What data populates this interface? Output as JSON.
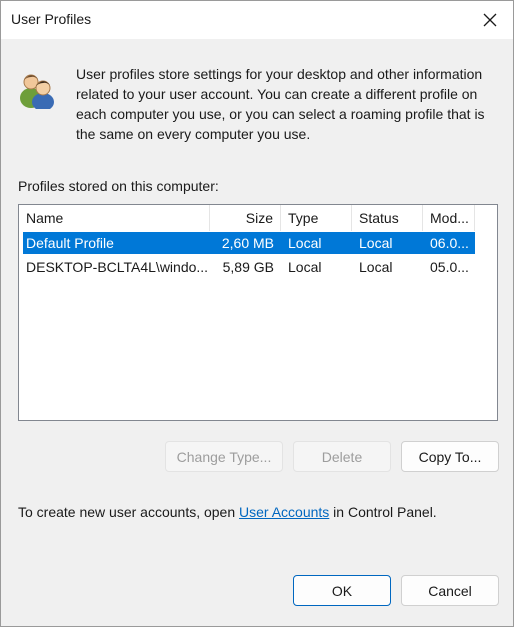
{
  "window": {
    "title": "User Profiles"
  },
  "intro_text": "User profiles store settings for your desktop and other information related to your user account. You can create a different profile on each computer you use, or you can select a roaming profile that is the same on every computer you use.",
  "profiles": {
    "label": "Profiles stored on this computer:",
    "columns": [
      "Name",
      "Size",
      "Type",
      "Status",
      "Mod..."
    ],
    "rows": [
      {
        "name": "Default Profile",
        "size": "2,60 MB",
        "type": "Local",
        "status": "Local",
        "modified": "06.0...",
        "selected": true
      },
      {
        "name": "DESKTOP-BCLTA4L\\windo...",
        "size": "5,89 GB",
        "type": "Local",
        "status": "Local",
        "modified": "05.0...",
        "selected": false
      }
    ]
  },
  "buttons": {
    "change_type": "Change Type...",
    "delete": "Delete",
    "copy_to": "Copy To...",
    "ok": "OK",
    "cancel": "Cancel"
  },
  "footer": {
    "prefix": "To create new user accounts, open ",
    "link": "User Accounts",
    "suffix": " in Control Panel."
  },
  "colors": {
    "selection": "#0078d7",
    "link": "#0067c0",
    "dialog_bg": "#f0f0f0"
  },
  "icons": {
    "close": "close-icon",
    "users": "users-icon"
  }
}
